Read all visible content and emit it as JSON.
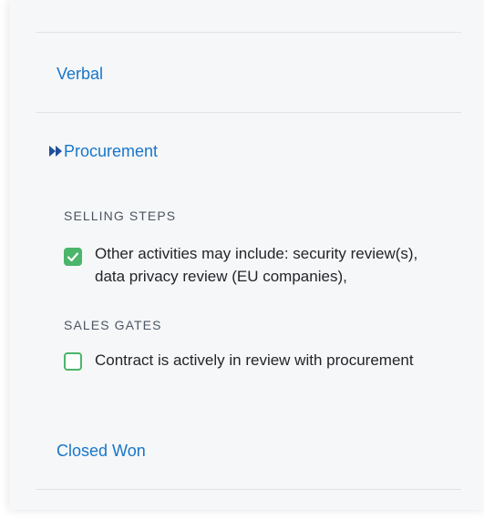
{
  "stages": {
    "verbal": {
      "label": "Verbal"
    },
    "procurement": {
      "label": "Procurement",
      "status_icon": "current-stage-chevron-icon"
    },
    "closed_won": {
      "label": "Closed Won"
    }
  },
  "selling_steps": {
    "heading": "SELLING STEPS",
    "items": [
      {
        "checked": true,
        "line1": "Other activities may include: security review(s),",
        "line2": "data privacy review (EU companies),"
      }
    ]
  },
  "sales_gates": {
    "heading": "SALES GATES",
    "items": [
      {
        "checked": false,
        "text": "Contract is actively in review with procurement"
      }
    ]
  },
  "colors": {
    "link": "#1876c8",
    "check_green": "#4bb56b",
    "panel_bg": "#f6f7f8"
  }
}
